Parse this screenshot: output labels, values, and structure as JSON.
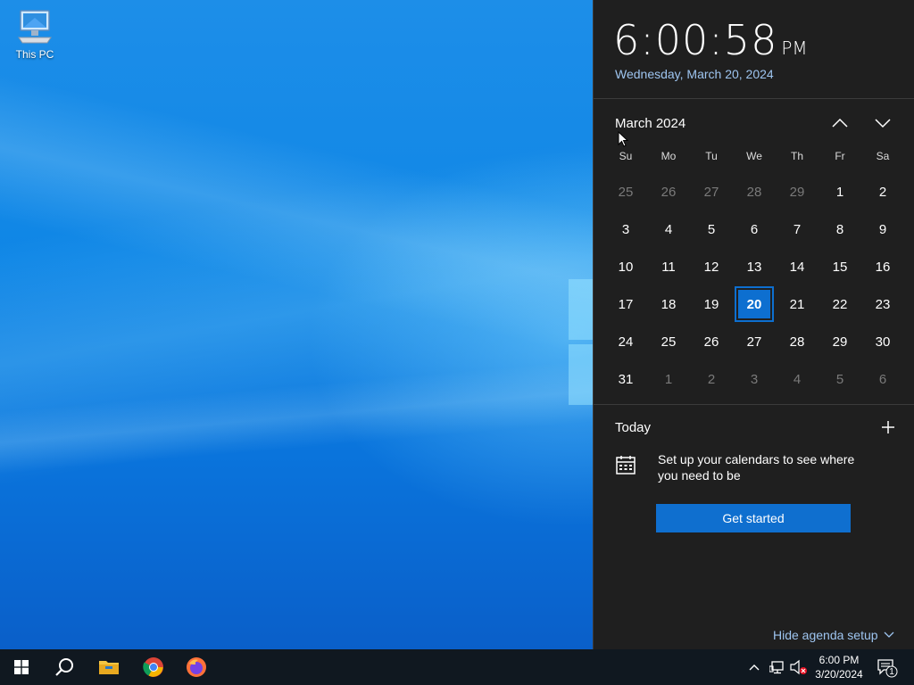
{
  "desktop": {
    "icons": [
      {
        "label": "This PC",
        "icon": "computer-icon"
      }
    ]
  },
  "flyout": {
    "time": "6:00:58",
    "ampm": "PM",
    "date": "Wednesday, March 20, 2024",
    "month_label": "March 2024",
    "weekdays": [
      "Su",
      "Mo",
      "Tu",
      "We",
      "Th",
      "Fr",
      "Sa"
    ],
    "days": [
      {
        "d": "25",
        "other": true
      },
      {
        "d": "26",
        "other": true
      },
      {
        "d": "27",
        "other": true
      },
      {
        "d": "28",
        "other": true
      },
      {
        "d": "29",
        "other": true
      },
      {
        "d": "1"
      },
      {
        "d": "2"
      },
      {
        "d": "3"
      },
      {
        "d": "4"
      },
      {
        "d": "5"
      },
      {
        "d": "6"
      },
      {
        "d": "7"
      },
      {
        "d": "8"
      },
      {
        "d": "9"
      },
      {
        "d": "10"
      },
      {
        "d": "11"
      },
      {
        "d": "12"
      },
      {
        "d": "13"
      },
      {
        "d": "14"
      },
      {
        "d": "15"
      },
      {
        "d": "16"
      },
      {
        "d": "17"
      },
      {
        "d": "18"
      },
      {
        "d": "19"
      },
      {
        "d": "20",
        "today": true
      },
      {
        "d": "21"
      },
      {
        "d": "22"
      },
      {
        "d": "23"
      },
      {
        "d": "24"
      },
      {
        "d": "25"
      },
      {
        "d": "26"
      },
      {
        "d": "27"
      },
      {
        "d": "28"
      },
      {
        "d": "29"
      },
      {
        "d": "30"
      },
      {
        "d": "31"
      },
      {
        "d": "1",
        "other": true
      },
      {
        "d": "2",
        "other": true
      },
      {
        "d": "3",
        "other": true
      },
      {
        "d": "4",
        "other": true
      },
      {
        "d": "5",
        "other": true
      },
      {
        "d": "6",
        "other": true
      }
    ],
    "today_label": "Today",
    "setup_text": "Set up your calendars to see where you need to be",
    "get_started": "Get started",
    "hide_agenda": "Hide agenda setup"
  },
  "taskbar": {
    "apps": [
      "start-icon",
      "search-icon",
      "file-explorer-icon",
      "chrome-icon",
      "firefox-icon"
    ],
    "clock_time": "6:00 PM",
    "clock_date": "3/20/2024",
    "notification_count": "1"
  },
  "colors": {
    "accent": "#0f6fcf",
    "flyout_bg": "#1f1f1f",
    "taskbar_bg": "#101820"
  }
}
